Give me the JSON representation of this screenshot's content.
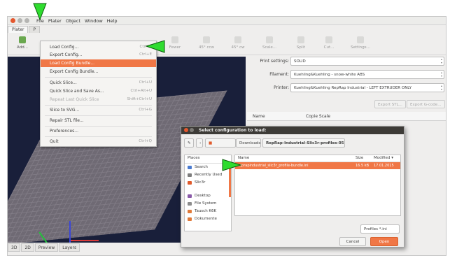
{
  "menubar": [
    "File",
    "Plater",
    "Object",
    "Window",
    "Help"
  ],
  "tabs": [
    "Plater",
    "P"
  ],
  "toolbar": [
    {
      "label": "Add...",
      "icon": "add-icon",
      "disabled": false
    },
    {
      "label": "Fewer",
      "icon": "minus-icon",
      "disabled": true
    },
    {
      "label": "45° ccw",
      "icon": "rotate-ccw-icon",
      "disabled": true
    },
    {
      "label": "45° cw",
      "icon": "rotate-cw-icon",
      "disabled": true
    },
    {
      "label": "Scale...",
      "icon": "scale-icon",
      "disabled": true
    },
    {
      "label": "Split",
      "icon": "split-icon",
      "disabled": true
    },
    {
      "label": "Cut...",
      "icon": "cut-icon",
      "disabled": true
    },
    {
      "label": "Settings...",
      "icon": "settings-icon",
      "disabled": true
    }
  ],
  "file_menu": [
    {
      "label": "Load Config...",
      "shortcut": "Ctrl+L"
    },
    {
      "label": "Export Config...",
      "shortcut": "Ctrl+E"
    },
    {
      "label": "Load Config Bundle...",
      "shortcut": "",
      "selected": true
    },
    {
      "label": "Export Config Bundle...",
      "shortcut": "",
      "sep_after": true
    },
    {
      "label": "Quick Slice...",
      "shortcut": "Ctrl+U"
    },
    {
      "label": "Quick Slice and Save As...",
      "shortcut": "Ctrl+Alt+U"
    },
    {
      "label": "Repeat Last Quick Slice",
      "shortcut": "Shift+Ctrl+U",
      "disabled": true,
      "sep_after": true
    },
    {
      "label": "Slice to SVG...",
      "shortcut": "Ctrl+G",
      "sep_after": true
    },
    {
      "label": "Repair STL file...",
      "shortcut": "",
      "sep_after": true
    },
    {
      "label": "Preferences...",
      "shortcut": "",
      "sep_after": true
    },
    {
      "label": "Quit",
      "shortcut": "Ctrl+Q"
    }
  ],
  "settings": {
    "print_label": "Print settings:",
    "print_value": "SOLID",
    "filament_label": "Filament:",
    "filament_value": "Kuehling&Kuehling - snow-white ABS",
    "printer_label": "Printer:",
    "printer_value": "Kuehling&Kuehling RepRap Industrial - LEFT EXTRUDER ONLY",
    "export_stl": "Export STL...",
    "export_gcode": "Export G-code...",
    "col_name": "Name",
    "col_copies": "Copie Scale"
  },
  "bottom_tabs": [
    "3D",
    "2D",
    "Preview",
    "Layers"
  ],
  "dialog": {
    "title": "Select configuration to load:",
    "path_buttons": [
      "Downloads",
      "RepRap-Industrial-Slic3r-profiles-05"
    ],
    "places_header": "Places",
    "places": [
      {
        "label": "Search",
        "icon": "search-icon"
      },
      {
        "label": "Recently Used",
        "icon": "clock-icon"
      },
      {
        "label": "Slic3r",
        "icon": "home-folder-icon",
        "selected": true
      },
      {
        "label": "Desktop",
        "icon": "desktop-icon",
        "gap": true
      },
      {
        "label": "File System",
        "icon": "drive-icon"
      },
      {
        "label": "Tausch K6K",
        "icon": "folder-icon"
      },
      {
        "label": "Dokumente",
        "icon": "folder-icon"
      }
    ],
    "files_columns": {
      "name": "Name",
      "size": "Size",
      "modified": "Modified ▾"
    },
    "files": [
      {
        "name": "reprapindustrial_slic3r_profile-bundle.ini",
        "size": "16.5 kB",
        "modified": "17.01.2015"
      }
    ],
    "filter": "Profiles *.ini",
    "cancel": "Cancel",
    "open": "Open"
  },
  "colors": {
    "accent": "#f07746",
    "arrow": "#2fdc2f",
    "viewport": "#191f3a"
  }
}
